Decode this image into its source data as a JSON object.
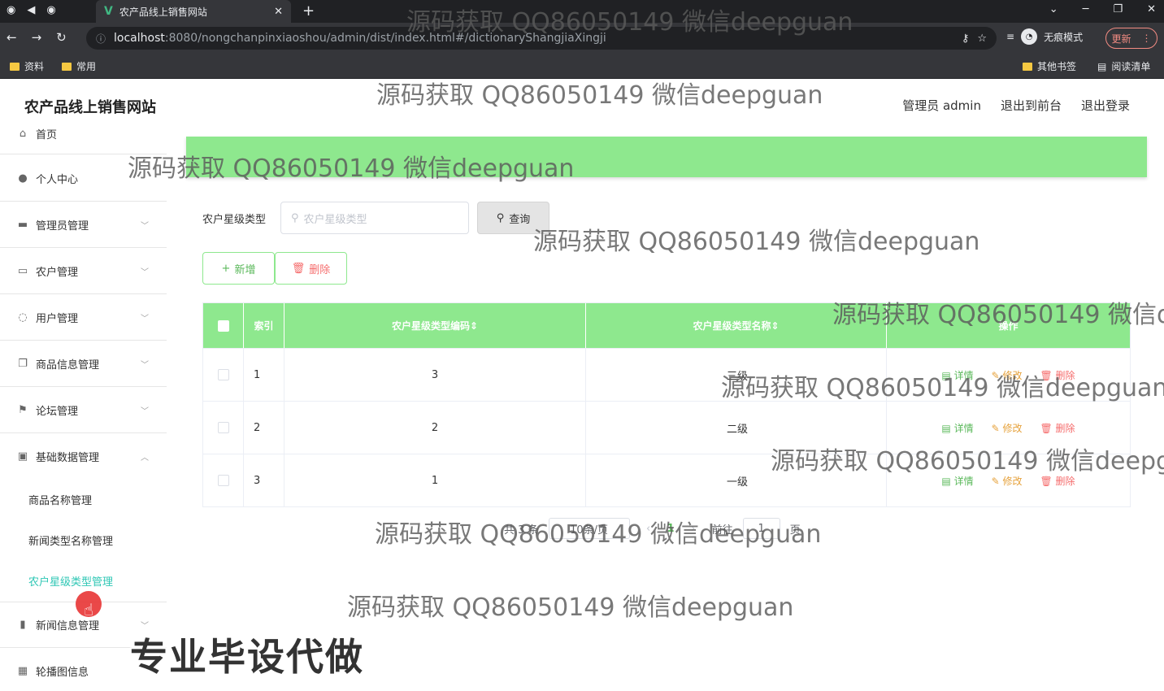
{
  "browser": {
    "tab_title": "农产品线上销售网站",
    "url_host": "localhost",
    "url_rest": ":8080/nongchanpinxiaoshou/admin/dist/index.html#/dictionaryShangjiaXingji",
    "incognito_label": "无痕模式",
    "update_label": "更新",
    "bookmarks": [
      "资料",
      "常用"
    ],
    "other_bookmarks": "其他书签",
    "reading_list": "阅读清单"
  },
  "header": {
    "site_title": "农产品线上销售网站",
    "admin_label": "管理员 admin",
    "to_front": "退出到前台",
    "logout": "退出登录"
  },
  "sidebar": {
    "items": [
      {
        "label": "首页",
        "icon": "home-icon"
      },
      {
        "label": "个人中心",
        "icon": "user-icon"
      },
      {
        "label": "管理员管理",
        "icon": "admin-icon"
      },
      {
        "label": "农户管理",
        "icon": "chat-icon"
      },
      {
        "label": "用户管理",
        "icon": "globe-icon"
      },
      {
        "label": "商品信息管理",
        "icon": "copy-icon"
      },
      {
        "label": "论坛管理",
        "icon": "flag-icon"
      },
      {
        "label": "基础数据管理",
        "icon": "briefcase-icon"
      },
      {
        "label": "新闻信息管理",
        "icon": "chart-icon"
      },
      {
        "label": "轮播图信息",
        "icon": "grid-icon"
      }
    ],
    "sub_items": [
      "商品名称管理",
      "新闻类型名称管理",
      "农户星级类型管理"
    ]
  },
  "search": {
    "label": "农户星级类型",
    "placeholder": "农户星级类型",
    "query_btn": "查询"
  },
  "actions": {
    "add": "新增",
    "delete": "删除"
  },
  "table": {
    "headers": [
      "索引",
      "农户星级类型编码",
      "农户星级类型名称",
      "操作"
    ],
    "rows": [
      {
        "index": "1",
        "code": "3",
        "name": "三级"
      },
      {
        "index": "2",
        "code": "2",
        "name": "二级"
      },
      {
        "index": "3",
        "code": "1",
        "name": "一级"
      }
    ],
    "op_detail": "详情",
    "op_edit": "修改",
    "op_delete": "删除"
  },
  "pager": {
    "total": "共 3 条",
    "page_size": "10条/页",
    "current": "1",
    "goto": "前往",
    "goto_value": "1",
    "page_unit": "页"
  },
  "overlay": {
    "watermark": "源码获取 QQ86050149 微信deepguan",
    "watermark_cut1": "源码获取 QQ86050149 微信d",
    "watermark_cut2": "源码获取 QQ86050149 微信deepg",
    "stamp": "专业毕设代做"
  },
  "colors": {
    "accent_green": "#8ee88e",
    "active_teal": "#2fc7b5",
    "danger": "#f56c6c",
    "warning": "#e6a23c"
  }
}
